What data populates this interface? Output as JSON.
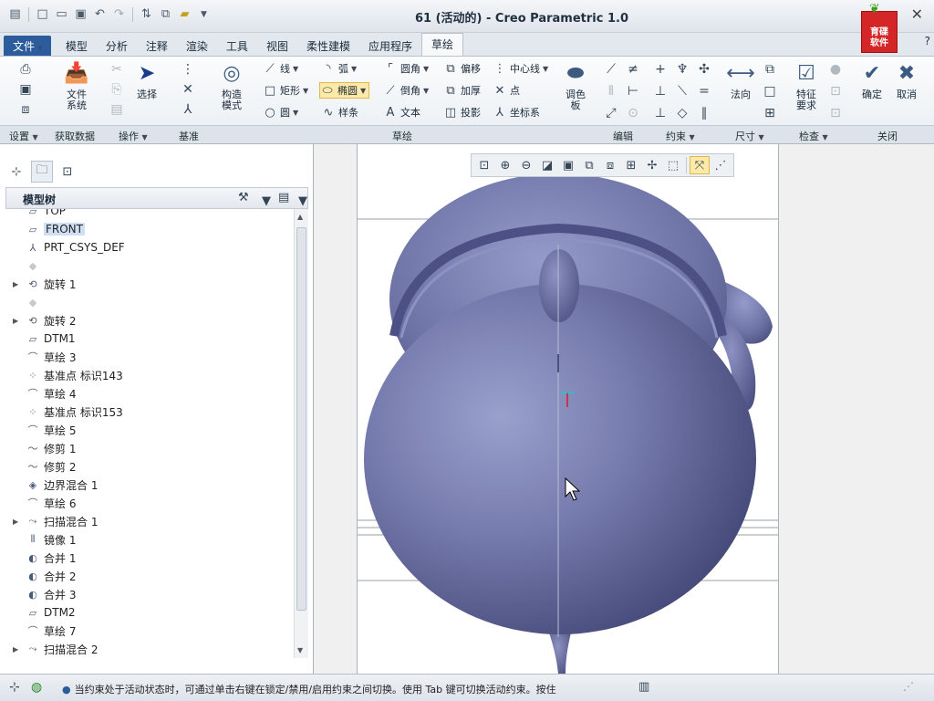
{
  "window": {
    "title": "61 (活动的) - Creo Parametric 1.0",
    "logo_line1": "育碟",
    "logo_line2": "软件",
    "help": "?"
  },
  "quick_access": [
    "new-icon",
    "open-icon",
    "save-icon",
    "undo-icon",
    "redo-icon",
    "regenerate-icon",
    "window-icon",
    "close-window-icon"
  ],
  "menu_tabs": [
    {
      "label": "文件",
      "kind": "file"
    },
    {
      "label": "模型"
    },
    {
      "label": "分析"
    },
    {
      "label": "注释"
    },
    {
      "label": "渲染"
    },
    {
      "label": "工具"
    },
    {
      "label": "视图"
    },
    {
      "label": "柔性建模"
    },
    {
      "label": "应用程序"
    },
    {
      "label": "草绘",
      "kind": "active"
    }
  ],
  "ribbon": {
    "file_system": "文件\n系统",
    "select": "选择",
    "construction_mode": "构造\n模式",
    "line": "线",
    "arc": "弧",
    "fillet": "圆角",
    "offset": "偏移",
    "centerline": "中心线",
    "rectangle": "矩形",
    "ellipse": "椭圆",
    "chamfer": "倒角",
    "thicken": "加厚",
    "point": "点",
    "circle": "圆",
    "spline": "样条",
    "text": "文本",
    "project": "投影",
    "coordsys": "坐标系",
    "palette": "调色\n板",
    "normal": "法向",
    "feature_requirements": "特征\n要求",
    "ok": "确定",
    "cancel": "取消",
    "groups": [
      "设置",
      "获取数据",
      "操作",
      "基准",
      "草绘",
      "编辑",
      "约束",
      "尺寸",
      "检查",
      "关闭"
    ]
  },
  "panel": {
    "tree_title": "模型树"
  },
  "tree": [
    {
      "label": "TOP",
      "icon": "datum-plane-icon"
    },
    {
      "label": "FRONT",
      "icon": "datum-plane-icon",
      "highlight": true
    },
    {
      "label": "PRT_CSYS_DEF",
      "icon": "csys-icon"
    },
    {
      "label": "",
      "icon": "feature-icon",
      "faded": true
    },
    {
      "label": "旋转 1",
      "icon": "revolve-icon",
      "expand": true
    },
    {
      "label": "",
      "icon": "feature-icon",
      "faded": true
    },
    {
      "label": "旋转 2",
      "icon": "revolve-icon",
      "expand": true
    },
    {
      "label": "DTM1",
      "icon": "datum-plane-icon"
    },
    {
      "label": "草绘 3",
      "icon": "sketch-icon"
    },
    {
      "label": "基准点 标识143",
      "icon": "datum-point-icon"
    },
    {
      "label": "草绘 4",
      "icon": "sketch-icon"
    },
    {
      "label": "基准点 标识153",
      "icon": "datum-point-icon"
    },
    {
      "label": "草绘 5",
      "icon": "sketch-icon"
    },
    {
      "label": "修剪 1",
      "icon": "trim-icon"
    },
    {
      "label": "修剪 2",
      "icon": "trim-icon"
    },
    {
      "label": "边界混合 1",
      "icon": "boundary-blend-icon"
    },
    {
      "label": "草绘 6",
      "icon": "sketch-icon"
    },
    {
      "label": "扫描混合 1",
      "icon": "swept-blend-icon",
      "expand": true
    },
    {
      "label": "镜像 1",
      "icon": "mirror-icon"
    },
    {
      "label": "合并 1",
      "icon": "merge-icon"
    },
    {
      "label": "合并 2",
      "icon": "merge-icon"
    },
    {
      "label": "合并 3",
      "icon": "merge-icon"
    },
    {
      "label": "DTM2",
      "icon": "datum-plane-icon"
    },
    {
      "label": "草绘 7",
      "icon": "sketch-icon"
    },
    {
      "label": "扫描混合 2",
      "icon": "swept-blend-icon",
      "expand": true
    }
  ],
  "status": {
    "message": "当约束处于活动状态时，可通过单击右键在锁定/禁用/启用约束之间切换。使用 Tab 键可切换活动约束。按住"
  },
  "colors": {
    "model": "#7479ab",
    "accent": "#2c5c9c"
  }
}
